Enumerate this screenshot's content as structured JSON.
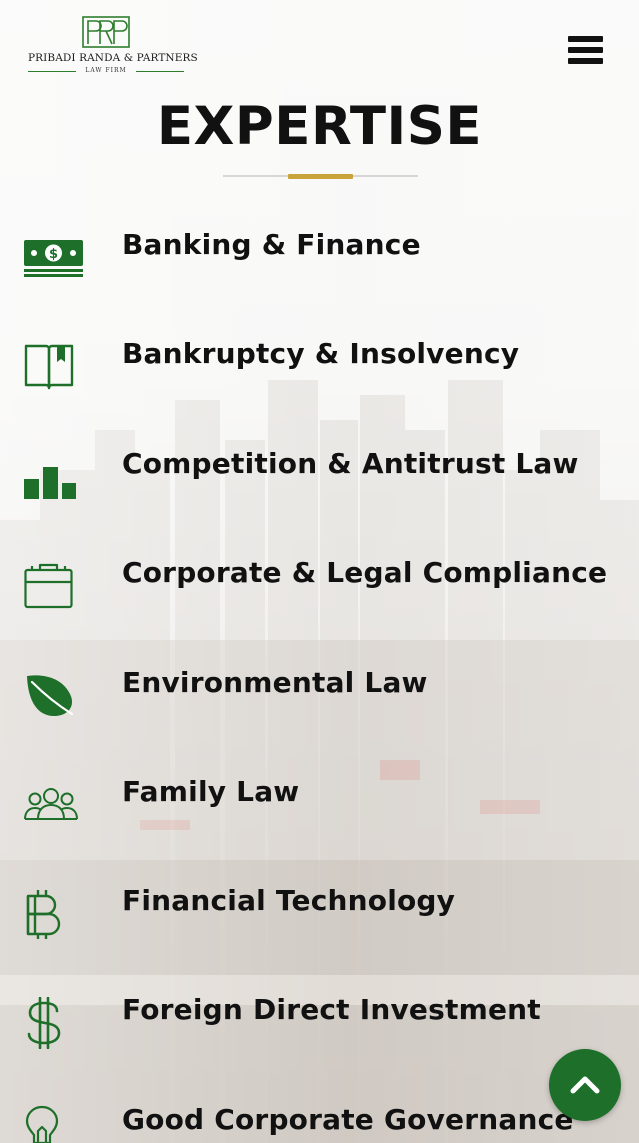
{
  "brand": {
    "name": "PRIBADI RANDA & PARTNERS",
    "sub": "LAW FIRM",
    "monogram": "PRP",
    "color": "#2d7d2d"
  },
  "header": {
    "menu_icon": "hamburger-menu-icon"
  },
  "section": {
    "title": "EXPERTISE",
    "accent_color": "#c9a43a"
  },
  "expertise": [
    {
      "label": "Banking & Finance",
      "icon": "money-bill-icon"
    },
    {
      "label": "Bankruptcy & Insolvency",
      "icon": "book-icon"
    },
    {
      "label": "Competition & Antitrust Law",
      "icon": "podium-chart-icon"
    },
    {
      "label": "Corporate & Legal Compliance",
      "icon": "briefcase-icon"
    },
    {
      "label": "Environmental Law",
      "icon": "leaf-icon"
    },
    {
      "label": "Family Law",
      "icon": "family-icon"
    },
    {
      "label": "Financial Technology",
      "icon": "bitcoin-icon"
    },
    {
      "label": "Foreign Direct Investment",
      "icon": "dollar-icon"
    },
    {
      "label": "Good Corporate Governance",
      "icon": "lightbulb-icon"
    }
  ],
  "icon_color": "#1e6f2a",
  "scroll_top": {
    "icon": "chevron-up-icon",
    "color": "#1e6f2a"
  }
}
